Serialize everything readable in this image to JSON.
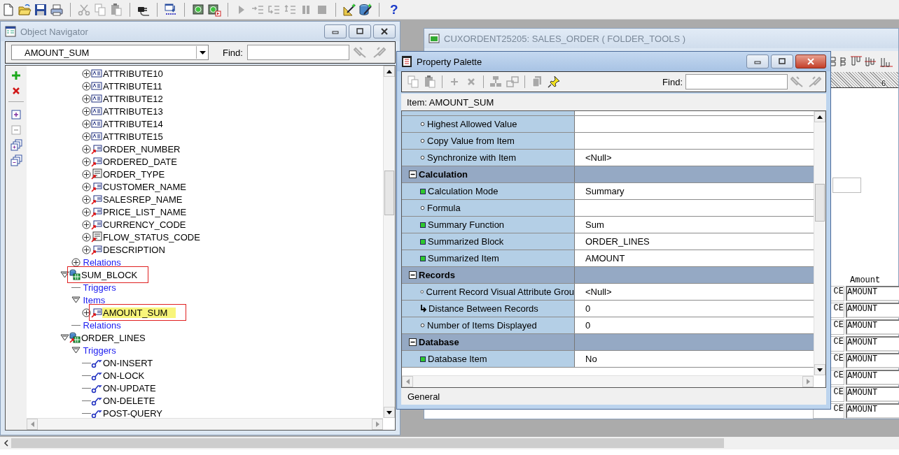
{
  "toolbar": [
    {
      "kind": "new",
      "disabled": false
    },
    {
      "kind": "open",
      "disabled": false
    },
    {
      "kind": "save",
      "disabled": false
    },
    {
      "kind": "print",
      "disabled": false
    },
    {
      "kind": "separator"
    },
    {
      "kind": "cut",
      "disabled": true
    },
    {
      "kind": "copy",
      "disabled": true
    },
    {
      "kind": "paste",
      "disabled": true
    },
    {
      "kind": "separator"
    },
    {
      "kind": "connect",
      "disabled": false
    },
    {
      "kind": "separator"
    },
    {
      "kind": "compile",
      "disabled": false
    },
    {
      "kind": "separator"
    },
    {
      "kind": "run",
      "disabled": false
    },
    {
      "kind": "debug",
      "disabled": false
    },
    {
      "kind": "separator"
    },
    {
      "kind": "play",
      "disabled": true
    },
    {
      "kind": "step-into",
      "disabled": true
    },
    {
      "kind": "step-over",
      "disabled": true
    },
    {
      "kind": "step-out",
      "disabled": true
    },
    {
      "kind": "pause",
      "disabled": true
    },
    {
      "kind": "stop",
      "disabled": true
    },
    {
      "kind": "separator"
    },
    {
      "kind": "layout-wizard",
      "disabled": false
    },
    {
      "kind": "data-wizard",
      "disabled": false
    },
    {
      "kind": "separator"
    },
    {
      "kind": "help",
      "glyph": "?",
      "disabled": false
    }
  ],
  "navigator": {
    "title": "Object Navigator",
    "active": false,
    "context": "AMOUNT_SUM",
    "find_label": "Find:",
    "side_tools": [
      {
        "kind": "create",
        "disabled": false
      },
      {
        "kind": "delete",
        "disabled": false
      },
      {
        "kind": "expand",
        "disabled": false
      },
      {
        "kind": "collapse",
        "disabled": true
      },
      {
        "kind": "expand-all",
        "disabled": false
      },
      {
        "kind": "collapse-all",
        "disabled": false
      }
    ],
    "tree": [
      {
        "children": [
          {
            "children": [
              {
                "label": "ATTRIBUTE10",
                "kind": "text-item",
                "expanded": false
              },
              {
                "label": "ATTRIBUTE11",
                "kind": "text-item",
                "expanded": false
              },
              {
                "label": "ATTRIBUTE12",
                "kind": "text-item",
                "expanded": false
              },
              {
                "label": "ATTRIBUTE13",
                "kind": "text-item",
                "expanded": false
              },
              {
                "label": "ATTRIBUTE14",
                "kind": "text-item",
                "expanded": false
              },
              {
                "label": "ATTRIBUTE15",
                "kind": "text-item",
                "expanded": false
              },
              {
                "label": "ORDER_NUMBER",
                "kind": "text-item-subclassed",
                "expanded": false
              },
              {
                "label": "ORDERED_DATE",
                "kind": "text-item-subclassed",
                "expanded": false
              },
              {
                "label": "ORDER_TYPE",
                "kind": "list-item-subclassed",
                "expanded": false
              },
              {
                "label": "CUSTOMER_NAME",
                "kind": "text-item-subclassed",
                "expanded": false
              },
              {
                "label": "SALESREP_NAME",
                "kind": "text-item-subclassed",
                "expanded": false
              },
              {
                "label": "PRICE_LIST_NAME",
                "kind": "text-item-subclassed",
                "expanded": false
              },
              {
                "label": "CURRENCY_CODE",
                "kind": "text-item-subclassed",
                "expanded": false
              },
              {
                "label": "FLOW_STATUS_CODE",
                "kind": "list-item-subclassed",
                "expanded": false
              },
              {
                "label": "DESCRIPTION",
                "kind": "text-item-subclassed",
                "expanded": false
              }
            ]
          },
          {
            "label": "Relations",
            "kind": "node",
            "expanded": false
          }
        ]
      },
      {
        "label": "SUM_BLOCK",
        "kind": "block",
        "expanded": true,
        "annotated": true,
        "children": [
          {
            "label": "Triggers",
            "kind": "node"
          },
          {
            "label": "Items",
            "kind": "node",
            "expanded": true,
            "children": [
              {
                "label": "AMOUNT_SUM",
                "kind": "text-item-subclassed",
                "expanded": false,
                "selected": true,
                "annotated": true
              }
            ]
          },
          {
            "label": "Relations",
            "kind": "node"
          }
        ]
      },
      {
        "label": "ORDER_LINES",
        "kind": "block-subclassed",
        "expanded": true,
        "children": [
          {
            "label": "Triggers",
            "kind": "node",
            "expanded": true,
            "children": [
              {
                "label": "ON-INSERT",
                "kind": "trigger"
              },
              {
                "label": "ON-LOCK",
                "kind": "trigger"
              },
              {
                "label": "ON-UPDATE",
                "kind": "trigger"
              },
              {
                "label": "ON-DELETE",
                "kind": "trigger"
              },
              {
                "label": "POST-QUERY",
                "kind": "trigger"
              }
            ]
          }
        ]
      }
    ]
  },
  "form_window": {
    "title": "CUXORDENT25205: SALES_ORDER ( FOLDER_TOOLS )",
    "active": false,
    "ruler_mark": "6",
    "column_header": "Amount",
    "rows": [
      {
        "column_1": "CE",
        "column_2": "AMOUNT"
      },
      {
        "column_1": "CE",
        "column_2": "AMOUNT"
      },
      {
        "column_1": "CE",
        "column_2": "AMOUNT"
      },
      {
        "column_1": "CE",
        "column_2": "AMOUNT"
      },
      {
        "column_1": "CE",
        "column_2": "AMOUNT"
      },
      {
        "column_1": "CE",
        "column_2": "AMOUNT"
      },
      {
        "column_1": "CE",
        "column_2": "AMOUNT"
      },
      {
        "column_1": "CE",
        "column_2": "AMOUNT"
      }
    ]
  },
  "property_palette": {
    "title": "Property Palette",
    "active": true,
    "find_label": "Find:",
    "context": "Item: AMOUNT_SUM",
    "tools": [
      {
        "kind": "copy",
        "disabled": true
      },
      {
        "kind": "paste",
        "disabled": true
      },
      {
        "kind": "separator"
      },
      {
        "kind": "add",
        "disabled": true
      },
      {
        "kind": "delete",
        "disabled": true
      },
      {
        "kind": "separator"
      },
      {
        "kind": "union",
        "disabled": true
      },
      {
        "kind": "intersect",
        "disabled": true
      },
      {
        "kind": "separator"
      },
      {
        "kind": "inherit",
        "disabled": true
      },
      {
        "kind": "pin",
        "disabled": false
      }
    ],
    "properties": [
      {
        "kind": "default",
        "label": "Highest Allowed Value"
      },
      {
        "kind": "default",
        "label": "Copy Value from Item"
      },
      {
        "kind": "default",
        "label": "Synchronize with Item",
        "value": "<Null>"
      },
      {
        "kind": "group",
        "label": "Calculation",
        "expanded": true
      },
      {
        "kind": "changed",
        "label": "Calculation Mode",
        "value": "Summary"
      },
      {
        "kind": "default",
        "label": "Formula"
      },
      {
        "kind": "changed",
        "label": "Summary Function",
        "value": "Sum"
      },
      {
        "kind": "changed",
        "label": "Summarized Block",
        "value": "ORDER_LINES"
      },
      {
        "kind": "changed",
        "label": "Summarized Item",
        "value": "AMOUNT"
      },
      {
        "kind": "group",
        "label": "Records",
        "expanded": true
      },
      {
        "kind": "default",
        "label": "Current Record Visual Attribute Grou",
        "value": "<Null>"
      },
      {
        "kind": "inherited",
        "label": "Distance Between Records",
        "value": "0"
      },
      {
        "kind": "default",
        "label": "Number of Items Displayed",
        "value": "0"
      },
      {
        "kind": "group",
        "label": "Database",
        "expanded": true
      },
      {
        "kind": "changed",
        "label": "Database Item",
        "value": "No"
      }
    ],
    "status": "General"
  }
}
